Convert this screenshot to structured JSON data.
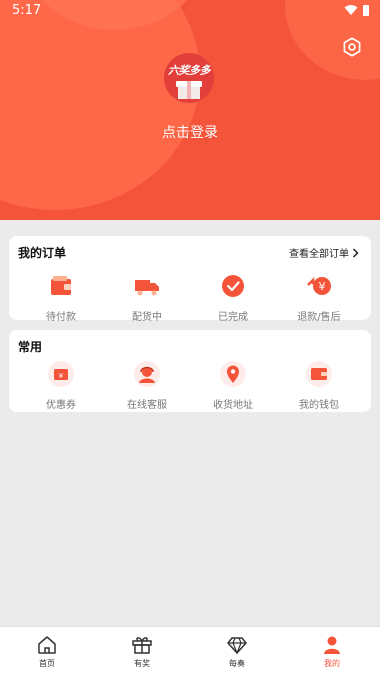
{
  "statusbar": {
    "time": "5:17"
  },
  "profile": {
    "logo_text": "六奖多多",
    "login_label": "点击登录"
  },
  "orders": {
    "title": "我的订单",
    "view_all": "查看全部订单",
    "items": [
      {
        "label": "待付款",
        "icon": "wallet-icon"
      },
      {
        "label": "配货中",
        "icon": "truck-icon"
      },
      {
        "label": "已完成",
        "icon": "check-circle-icon"
      },
      {
        "label": "退款/售后",
        "icon": "refund-icon"
      }
    ]
  },
  "common": {
    "title": "常用",
    "items": [
      {
        "label": "优惠券",
        "icon": "coupon-icon"
      },
      {
        "label": "在线客服",
        "icon": "customer-service-icon"
      },
      {
        "label": "收货地址",
        "icon": "location-icon"
      },
      {
        "label": "我的钱包",
        "icon": "wallet-icon"
      }
    ]
  },
  "nav": {
    "items": [
      {
        "label": "首页",
        "icon": "home-icon"
      },
      {
        "label": "有奖",
        "icon": "gift-icon"
      },
      {
        "label": "每奏",
        "icon": "diamond-icon"
      },
      {
        "label": "我的",
        "icon": "user-icon",
        "active": true
      }
    ]
  },
  "colors": {
    "accent": "#f4553a",
    "background": "#ebebeb"
  }
}
